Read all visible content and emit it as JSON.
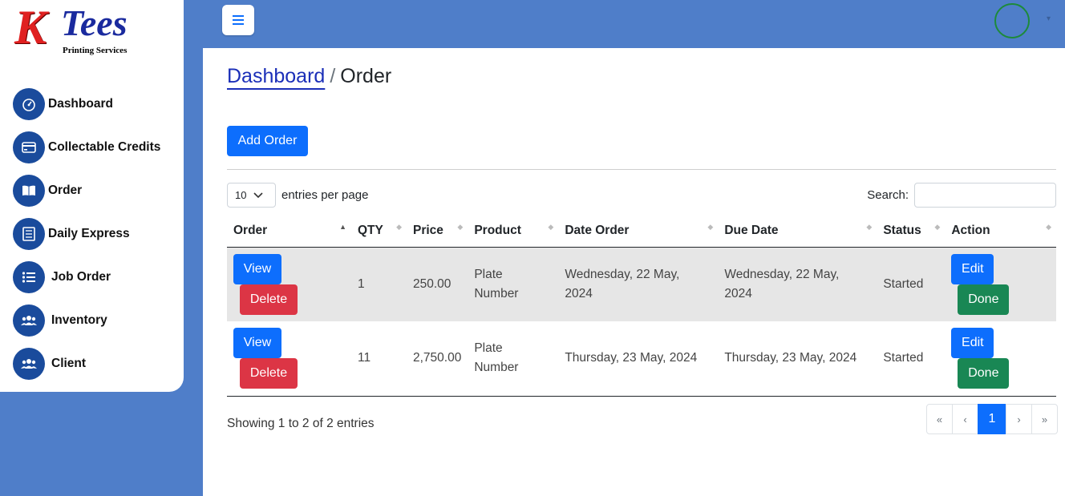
{
  "brand": {
    "logo_k": "K",
    "logo_tees": "Tees",
    "logo_sub": "Printing Services"
  },
  "sidebar": {
    "items": [
      {
        "label": "Dashboard",
        "icon": "speedometer-icon"
      },
      {
        "label": "Collectable Credits",
        "icon": "credit-card-icon"
      },
      {
        "label": "Order",
        "icon": "book-icon"
      },
      {
        "label": "Daily Express",
        "icon": "receipt-icon"
      },
      {
        "label": "Job Order",
        "icon": "list-icon"
      },
      {
        "label": "Inventory",
        "icon": "people-icon"
      },
      {
        "label": "Client",
        "icon": "people-icon"
      }
    ]
  },
  "topbar": {
    "toggle_icon": "hamburger-icon"
  },
  "breadcrumb": {
    "parent": "Dashboard",
    "separator": "/",
    "current": "Order"
  },
  "toolbar": {
    "add_label": "Add Order"
  },
  "table_controls": {
    "entries_value": "10",
    "entries_label": "entries per page",
    "search_label": "Search:"
  },
  "table": {
    "headers": [
      "Order",
      "QTY",
      "Price",
      "Product",
      "Date Order",
      "Due Date",
      "Status",
      "Action"
    ],
    "rows": [
      {
        "qty": "1",
        "price": "250.00",
        "product": "Plate Number",
        "date_order": "Wednesday, 22 May, 2024",
        "due_date": "Wednesday, 22 May, 2024",
        "status": "Started"
      },
      {
        "qty": "11",
        "price": "2,750.00",
        "product": "Plate Number",
        "date_order": "Thursday, 23 May, 2024",
        "due_date": "Thursday, 23 May, 2024",
        "status": "Started"
      }
    ],
    "view_label": "View",
    "delete_label": "Delete",
    "edit_label": "Edit",
    "done_label": "Done"
  },
  "footer": {
    "info": "Showing 1 to 2 of 2 entries"
  },
  "pagination": {
    "first": "«",
    "prev": "‹",
    "current": "1",
    "next": "›",
    "last": "»"
  },
  "colors": {
    "primary": "#0d6efd",
    "danger": "#dc3545",
    "success": "#198754",
    "topbar": "#4f7ec9",
    "nav_icon_bg": "#1a4b9c"
  }
}
